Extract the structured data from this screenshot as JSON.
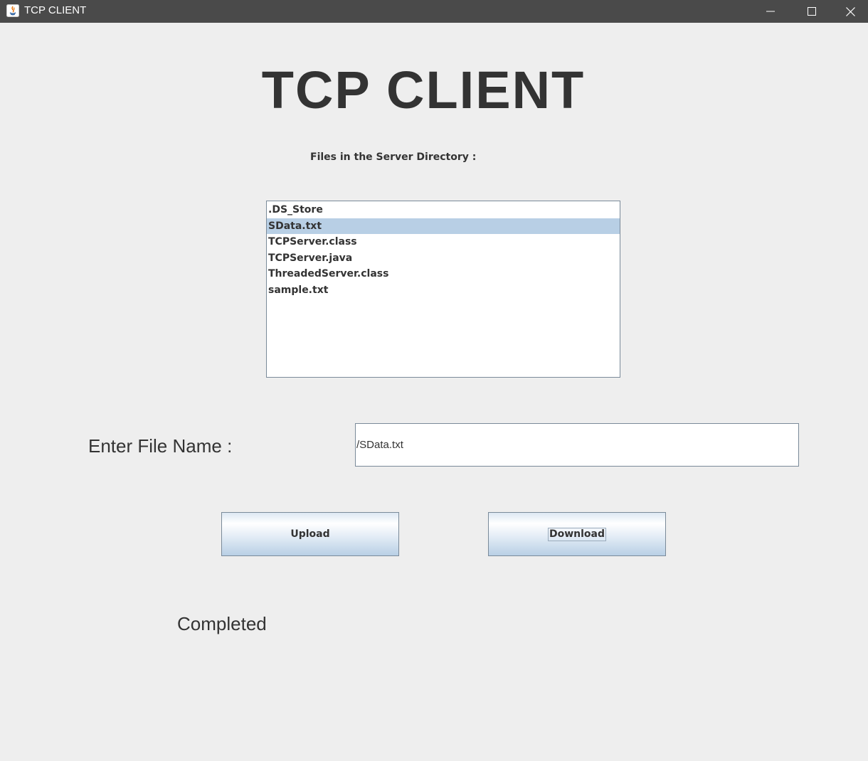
{
  "window": {
    "title": "TCP CLIENT",
    "controls": [
      "minimize-icon",
      "maximize-icon",
      "close-icon"
    ]
  },
  "main": {
    "heading": "TCP CLIENT",
    "directory_label": "Files in the Server Directory :",
    "files": [
      {
        "name": ".DS_Store",
        "selected": false
      },
      {
        "name": "SData.txt",
        "selected": true
      },
      {
        "name": "TCPServer.class",
        "selected": false
      },
      {
        "name": "TCPServer.java",
        "selected": false
      },
      {
        "name": "ThreadedServer.class",
        "selected": false
      },
      {
        "name": "sample.txt",
        "selected": false
      }
    ],
    "file_name_label": "Enter File Name :",
    "file_name_value": "/SData.txt",
    "upload_label": "Upload",
    "download_label": "Download",
    "status": "Completed"
  },
  "colors": {
    "titlebar": "#4a4a4a",
    "background": "#eeeeee",
    "selection": "#b8cfe5",
    "text": "#333333"
  }
}
